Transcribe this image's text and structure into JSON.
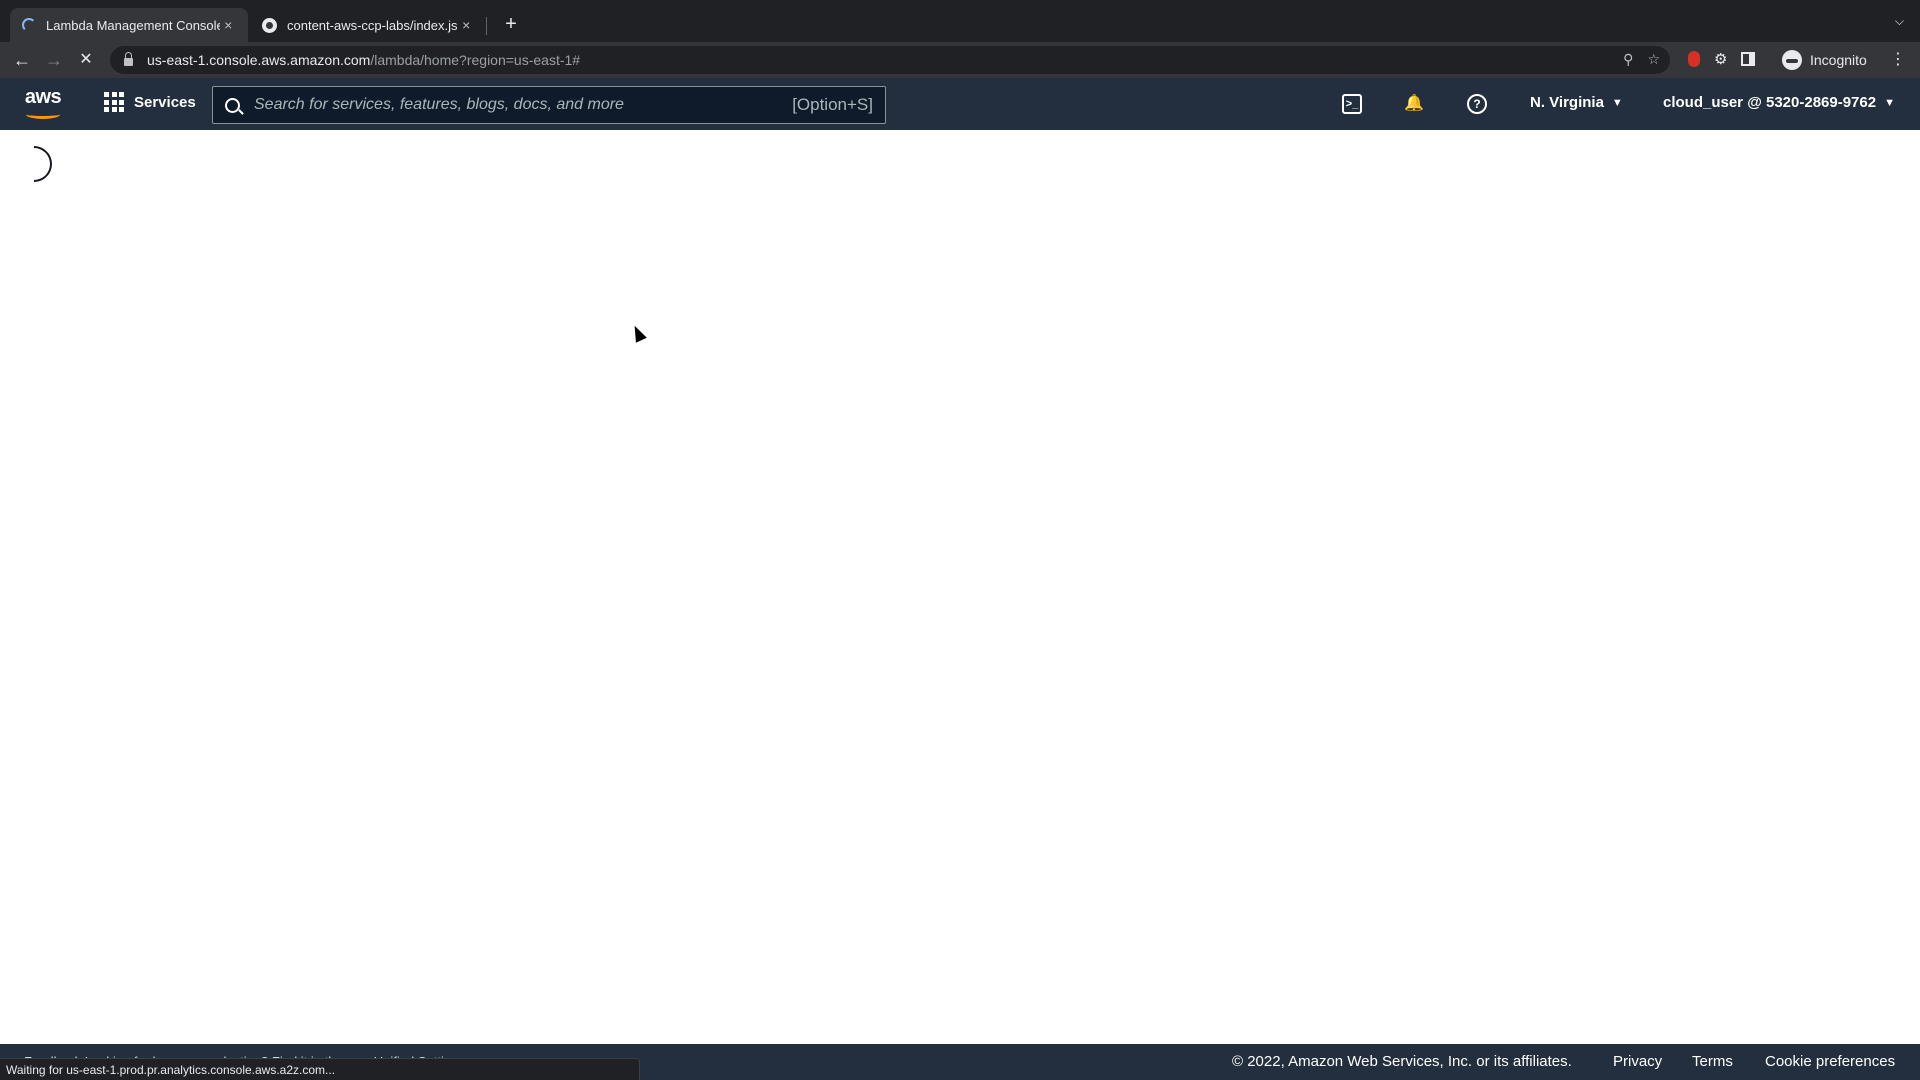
{
  "browser": {
    "tabs": [
      {
        "title": "Lambda Management Console",
        "close": "×"
      },
      {
        "title": "content-aws-ccp-labs/index.js",
        "close": "×"
      }
    ],
    "new_tab": "+",
    "url_host": "us-east-1.console.aws.amazon.com",
    "url_path": "/lambda/home?region=us-east-1#",
    "profile": "Incognito",
    "status": "Waiting for us-east-1.prod.pr.analytics.console.aws.a2z.com..."
  },
  "aws_header": {
    "logo": "aws",
    "services": "Services",
    "search_placeholder": "Search for services, features, blogs, docs, and more",
    "search_shortcut": "[Option+S]",
    "region": "N. Virginia",
    "account": "cloud_user @ 5320-2869-9762"
  },
  "footer": {
    "left_text": "Feedback   Looking for language selection? Find it in the new Unified Settings",
    "copyright": "© 2022, Amazon Web Services, Inc. or its affiliates.",
    "links": [
      "Privacy",
      "Terms",
      "Cookie preferences"
    ]
  },
  "colors": {
    "aws_header": "#232f3e",
    "aws_orange": "#ff9900",
    "chrome_dark": "#202124"
  }
}
